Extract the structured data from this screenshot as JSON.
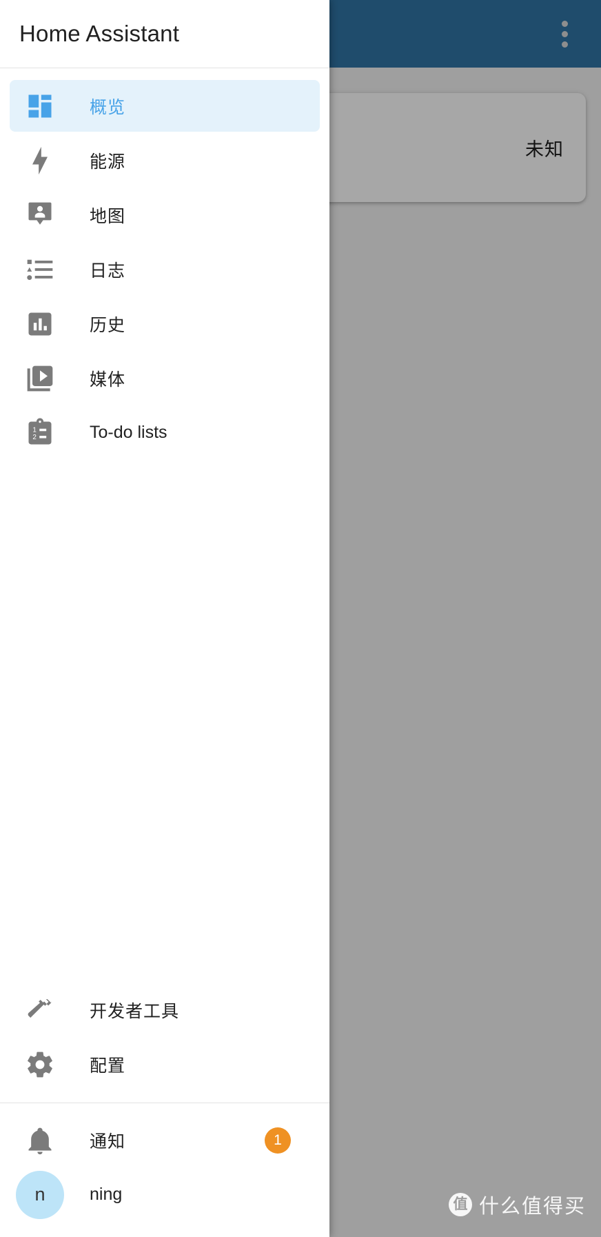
{
  "drawer": {
    "title": "Home Assistant",
    "main_items": [
      {
        "label": "概览",
        "icon": "view-dashboard-icon",
        "active": true
      },
      {
        "label": "能源",
        "icon": "lightning-bolt-icon",
        "active": false
      },
      {
        "label": "地图",
        "icon": "map-marker-account-icon",
        "active": false
      },
      {
        "label": "日志",
        "icon": "format-list-bulleted-type-icon",
        "active": false
      },
      {
        "label": "历史",
        "icon": "chart-box-icon",
        "active": false
      },
      {
        "label": "媒体",
        "icon": "play-box-multiple-icon",
        "active": false
      },
      {
        "label": "To-do lists",
        "icon": "clipboard-list-icon",
        "active": false
      }
    ],
    "tool_items": [
      {
        "label": "开发者工具",
        "icon": "hammer-icon"
      },
      {
        "label": "配置",
        "icon": "cog-icon"
      }
    ],
    "notifications": {
      "label": "通知",
      "icon": "bell-icon",
      "badge_count": "1",
      "badge_color": "#ef9123"
    },
    "user": {
      "name": "ning",
      "avatar_initial": "n",
      "avatar_color": "#bde4f8"
    },
    "active_accent_color": "#48a3e8",
    "active_background_color": "#e4f2fb"
  },
  "app_bar": {
    "background_color": "#2f74a5",
    "overflow_menu_icon": "dots-vertical-icon"
  },
  "background_card": {
    "state_text": "未知"
  },
  "watermark": {
    "logo_char": "值",
    "text": "什么值得买"
  }
}
